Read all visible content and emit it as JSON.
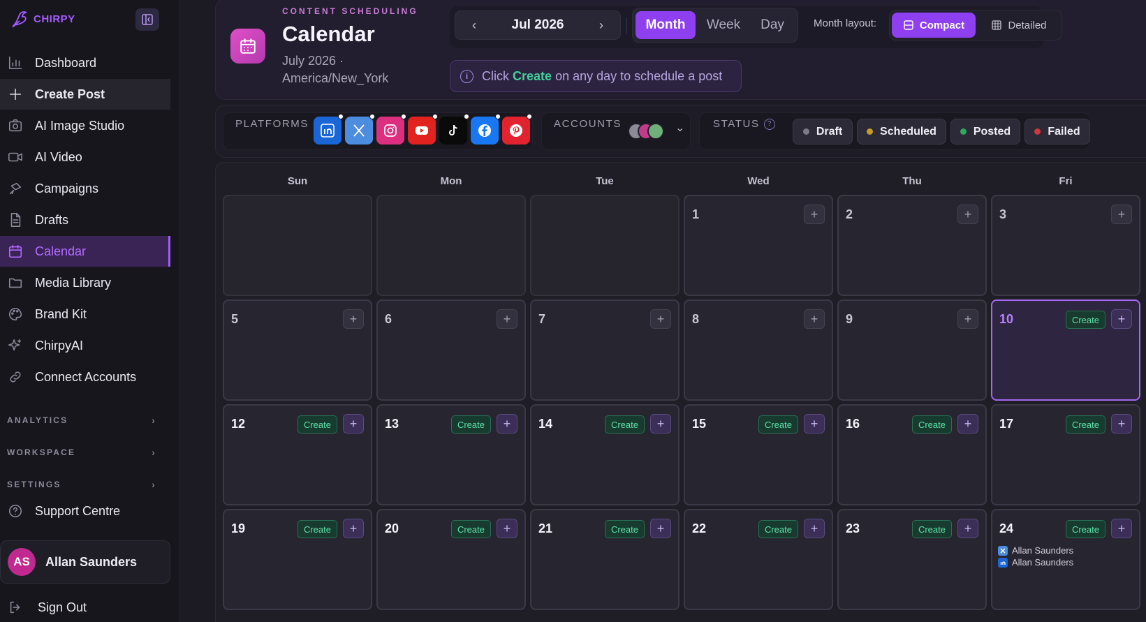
{
  "sidebar": {
    "brand": "CHIRPY",
    "nav": [
      {
        "label": "Dashboard",
        "icon": "bar-chart-icon"
      },
      {
        "label": "Create Post",
        "icon": "plus-icon"
      },
      {
        "label": "AI Image Studio",
        "icon": "camera-icon"
      },
      {
        "label": "AI Video",
        "icon": "video-icon"
      },
      {
        "label": "Campaigns",
        "icon": "megaphone-icon"
      },
      {
        "label": "Drafts",
        "icon": "document-icon"
      },
      {
        "label": "Calendar",
        "icon": "calendar-icon"
      },
      {
        "label": "Media Library",
        "icon": "folder-icon"
      },
      {
        "label": "Brand Kit",
        "icon": "palette-icon"
      },
      {
        "label": "ChirpyAI",
        "icon": "sparkles-icon"
      },
      {
        "label": "Connect Accounts",
        "icon": "link-icon"
      }
    ],
    "sections": [
      "ANALYTICS",
      "WORKSPACE",
      "SETTINGS"
    ],
    "support": "Support Centre",
    "user": {
      "initials": "AS",
      "name": "Allan Saunders"
    },
    "signout": "Sign Out"
  },
  "header": {
    "eyebrow": "CONTENT SCHEDULING",
    "title": "Calendar",
    "subtitle": "July 2026 · America/New_York",
    "date_label": "Jul 2026",
    "views": [
      "Month",
      "Week",
      "Day"
    ],
    "active_view": "Month",
    "layout_label": "Month layout:",
    "layouts": [
      "Compact",
      "Detailed"
    ],
    "active_layout": "Compact",
    "hint_prefix": "Click",
    "hint_keyword": "Create",
    "hint_suffix": "on any day to schedule a post"
  },
  "filters": {
    "platforms_label": "PLATFORMS",
    "platforms": [
      {
        "name": "linkedin",
        "color": "#1a66d6"
      },
      {
        "name": "x",
        "color": "#4c8de0"
      },
      {
        "name": "instagram",
        "color": "#dc2f7f"
      },
      {
        "name": "youtube",
        "color": "#e1221e"
      },
      {
        "name": "tiktok",
        "color": "#0a0a0a"
      },
      {
        "name": "facebook",
        "color": "#1877f2"
      },
      {
        "name": "pinterest",
        "color": "#e0232e"
      }
    ],
    "accounts_label": "ACCOUNTS",
    "status_label": "STATUS",
    "statuses": [
      {
        "label": "Draft",
        "color": "#7d7a88"
      },
      {
        "label": "Scheduled",
        "color": "#c99a2a"
      },
      {
        "label": "Posted",
        "color": "#2fa760"
      },
      {
        "label": "Failed",
        "color": "#d0383f"
      }
    ]
  },
  "calendar": {
    "weekdays": [
      "Sun",
      "Mon",
      "Tue",
      "Wed",
      "Thu",
      "Fri"
    ],
    "create_label": "Create",
    "rows": [
      [
        null,
        null,
        null,
        "1",
        "2",
        "3"
      ],
      [
        "5",
        "6",
        "7",
        "8",
        "9",
        "10"
      ],
      [
        "12",
        "13",
        "14",
        "15",
        "16",
        "17"
      ],
      [
        "19",
        "20",
        "21",
        "22",
        "23",
        "24"
      ]
    ],
    "today": "10",
    "posts_day": "24",
    "posts": [
      {
        "platform": "x",
        "account": "Allan Saunders"
      },
      {
        "platform": "linkedin",
        "account": "Allan Saunders"
      }
    ]
  }
}
